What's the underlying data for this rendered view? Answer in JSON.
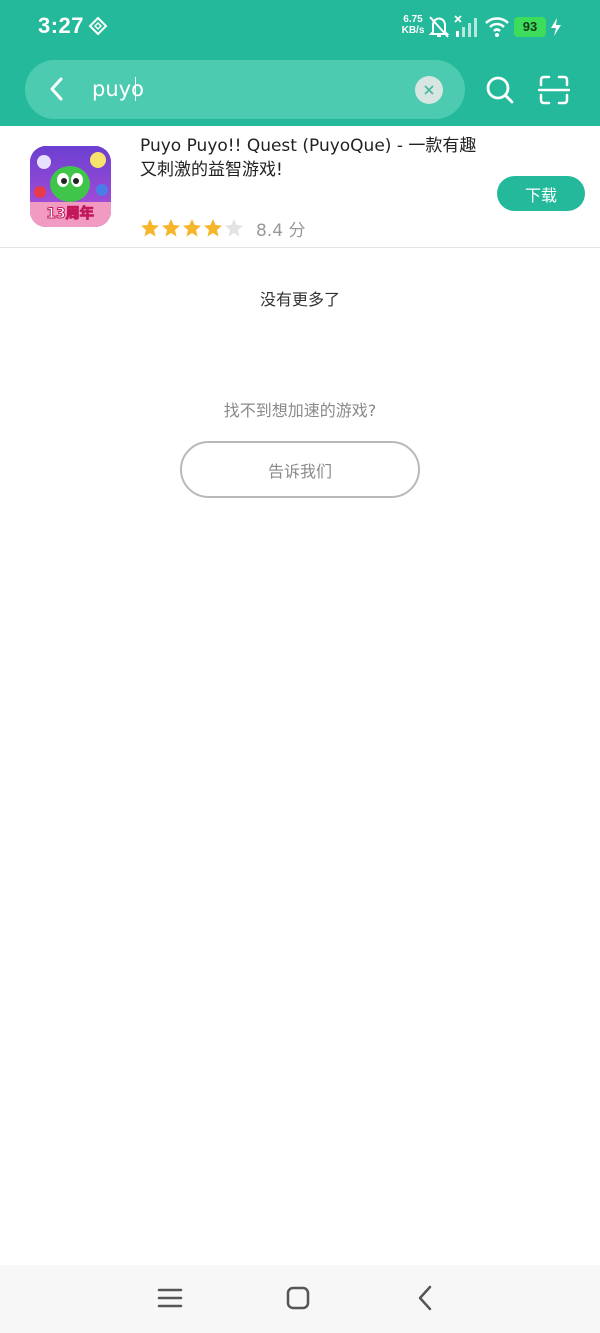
{
  "status_bar": {
    "time": "3:27",
    "net_speed_value": "6.75",
    "net_speed_unit": "KB/s",
    "battery_level": "93",
    "icons": [
      "diamond-icon",
      "mute-bell-icon",
      "signal-icon",
      "wifi-icon",
      "battery-icon",
      "charging-icon"
    ]
  },
  "search": {
    "query": "puyo",
    "icons": [
      "back-arrow-icon",
      "clear-icon",
      "search-icon",
      "scan-icon"
    ]
  },
  "result": {
    "title": "Puyo Puyo!! Quest (PuyoQue) - 一款有趣又刺激的益智游戏!",
    "icon_badge": "13周年",
    "rating_stars": 4,
    "rating_max": 5,
    "score": "8.4 分",
    "download_label": "下载"
  },
  "messages": {
    "no_more": "没有更多了",
    "cant_find": "找不到想加速的游戏?",
    "tell_us": "告诉我们"
  },
  "colors": {
    "brand": "#23b99a",
    "search_pill": "#4ccbb0",
    "star": "#f7b52c",
    "star_empty": "#e3e3e3"
  },
  "nav": {
    "icons": [
      "menu-icon",
      "home-icon",
      "back-icon"
    ]
  }
}
